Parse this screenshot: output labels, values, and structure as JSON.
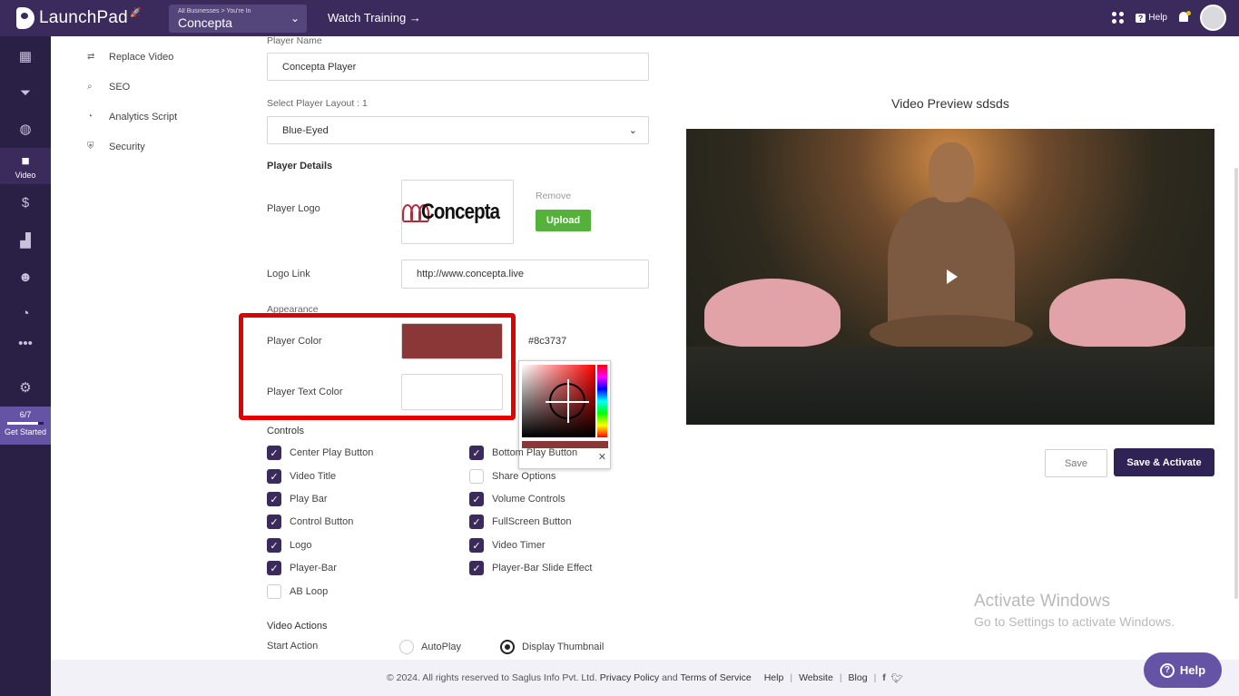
{
  "brand": {
    "name": "LaunchPad"
  },
  "business": {
    "caption": "All Businesses > You're In",
    "name": "Concepta"
  },
  "topbar": {
    "watch_training": "Watch Training →",
    "help": "Help"
  },
  "rail": {
    "video_label": "Video",
    "progress": "6/7",
    "progress_fraction": 0.86,
    "get_started": "Get Started"
  },
  "submenu": [
    {
      "label": "Replace Video",
      "icon": "swap-icon"
    },
    {
      "label": "SEO",
      "icon": "search-icon"
    },
    {
      "label": "Analytics Script",
      "icon": "chart-icon"
    },
    {
      "label": "Security",
      "icon": "shield-icon"
    }
  ],
  "form": {
    "player_name_label": "Player Name",
    "player_name_value": "Concepta Player",
    "layout_label": "Select Player Layout : 1",
    "layout_value": "Blue-Eyed",
    "player_details": "Player Details",
    "player_logo_label": "Player Logo",
    "logo_text": "Concepta",
    "remove": "Remove",
    "upload": "Upload",
    "logo_link_label": "Logo Link",
    "logo_link_value": "http://www.concepta.live",
    "appearance": "Appearance",
    "player_color_label": "Player Color",
    "player_color_hex": "#8c3737",
    "player_text_color_label": "Player Text Color",
    "player_text_color": "#ffffff",
    "controls_heading": "Controls",
    "video_actions": "Video Actions",
    "start_action": "Start Action",
    "autoplay": "AutoPlay",
    "display_thumbnail": "Display Thumbnail"
  },
  "controls": [
    {
      "label": "Center Play Button",
      "checked": true
    },
    {
      "label": "Bottom Play Button",
      "checked": true
    },
    {
      "label": "Video Title",
      "checked": true
    },
    {
      "label": "Share Options",
      "checked": false
    },
    {
      "label": "Play Bar",
      "checked": true
    },
    {
      "label": "Volume Controls",
      "checked": true
    },
    {
      "label": "Control Button",
      "checked": true
    },
    {
      "label": "FullScreen Button",
      "checked": true
    },
    {
      "label": "Logo",
      "checked": true
    },
    {
      "label": "Video Timer",
      "checked": true
    },
    {
      "label": "Player-Bar",
      "checked": true
    },
    {
      "label": "Player-Bar Slide Effect",
      "checked": true
    },
    {
      "label": "AB Loop",
      "checked": false
    }
  ],
  "preview": {
    "title": "Video Preview sdsds",
    "save": "Save",
    "save_activate": "Save & Activate"
  },
  "watermark": {
    "line1": "Activate Windows",
    "line2": "Go to Settings to activate Windows."
  },
  "footer": {
    "copyright": "©  2024. All rights reserved to Saglus Info Pvt. Ltd.",
    "privacy": "Privacy Policy",
    "and": "and",
    "terms": "Terms of Service",
    "help": "Help",
    "website": "Website",
    "blog": "Blog"
  },
  "help_button": "Help",
  "colors": {
    "accent": "#3b2a5c",
    "rail": "#2a1f44",
    "upload": "#54b23b",
    "highlight": "#e10000"
  }
}
